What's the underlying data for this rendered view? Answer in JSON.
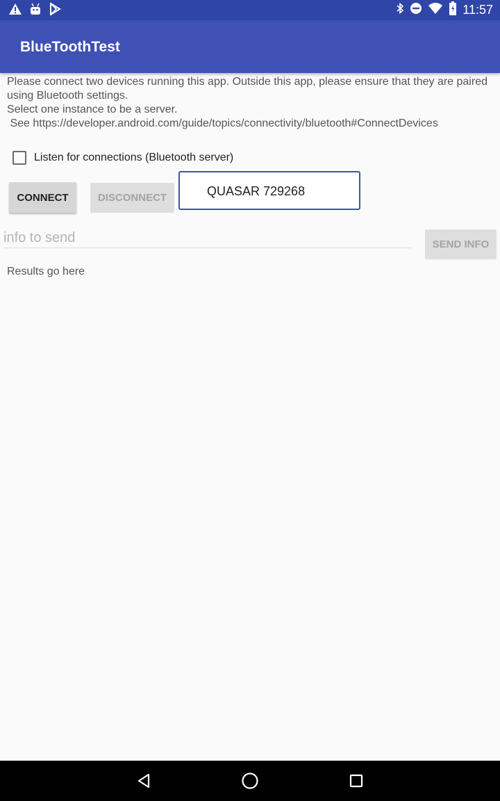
{
  "status_bar": {
    "time": "11:57",
    "left_icons": [
      "warning-icon",
      "android-icon",
      "play-store-icon"
    ],
    "right_icons": [
      "bluetooth-icon",
      "do-not-disturb-icon",
      "wifi-icon",
      "battery-icon"
    ]
  },
  "app_bar": {
    "title": "BlueToothTest"
  },
  "instructions": {
    "text": "Please connect two devices running this app. Outside this app, please ensure that they are paired using Bluetooth settings.\nSelect one instance to be a server.\n See https://developer.android.com/guide/topics/connectivity/bluetooth#ConnectDevices"
  },
  "listen": {
    "label": "Listen for connections (Bluetooth server)",
    "checked": false
  },
  "buttons": {
    "connect": "CONNECT",
    "disconnect": "DISCONNECT",
    "send": "SEND INFO"
  },
  "device": {
    "name": "QUASAR 729268"
  },
  "info_input": {
    "value": "",
    "placeholder": "info to send"
  },
  "results": {
    "text": "Results go here"
  },
  "nav_bar": {
    "buttons": [
      "back-icon",
      "home-icon",
      "recents-icon"
    ]
  },
  "colors": {
    "primary": "#3f51b5",
    "primary_dark": "#3045a8",
    "background": "#fafafa"
  }
}
